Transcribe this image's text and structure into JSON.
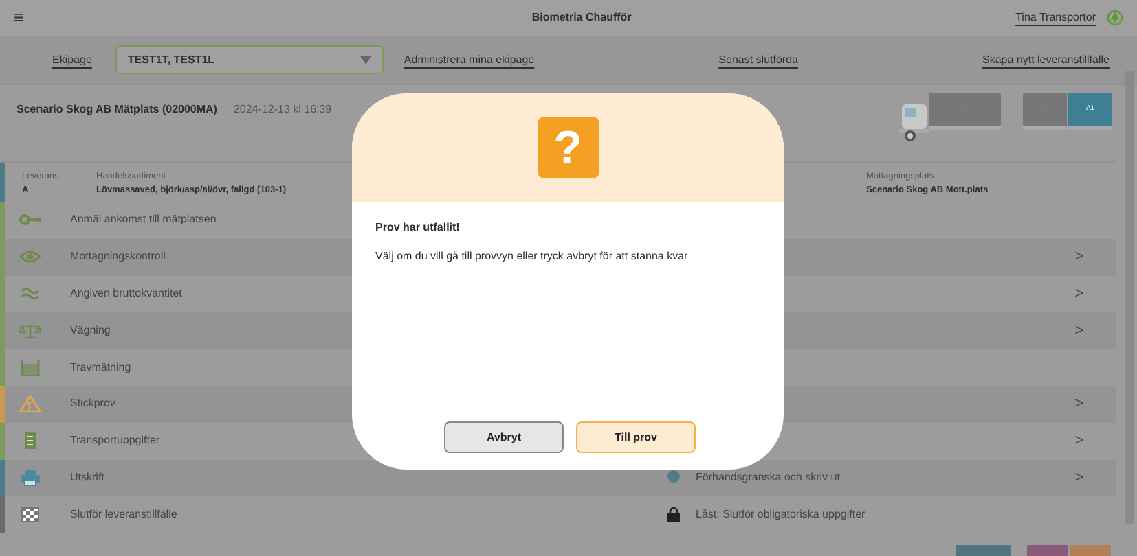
{
  "app_bar": {
    "menu": "≡",
    "title": "Biometria Chaufför",
    "user": "Tina Transportor"
  },
  "nav": {
    "ekipage_label": "Ekipage",
    "ekipage_value": "TEST1T, TEST1L",
    "links": [
      "Administrera mina ekipage",
      "Senast slutförda",
      "Skapa nytt leveranstillfälle"
    ]
  },
  "site": {
    "name": "Scenario Skog AB Mätplats (02000MA)",
    "timestamp": "2024-12-13 kl 16:39"
  },
  "truck": {
    "units": [
      {
        "label": "-",
        "selected": false
      },
      {
        "label": "-",
        "selected": false
      },
      {
        "label": "A1",
        "selected": true
      }
    ]
  },
  "delivery": {
    "color": "#4e7d8a",
    "fields": [
      {
        "label": "Leverans",
        "value": "A"
      },
      {
        "label": "Handelssortiment",
        "value": "Lövmassaved, björk/asp/al/övr, fallgd (103-1)"
      }
    ],
    "receiving": {
      "label": "Mottagningsplats",
      "value": "Scenario Skog AB Mott.plats"
    }
  },
  "steps": [
    {
      "kind": "step",
      "label": "Anmäl ankomst till mätplatsen",
      "color": "#7c9a5a"
    },
    {
      "kind": "step",
      "label": "Mottagningskontroll",
      "color": "#7c9a5a",
      "chevron": ">"
    },
    {
      "kind": "step",
      "label": "Angiven bruttokvantitet",
      "color": "#7c9a5a",
      "chevron": ">"
    },
    {
      "kind": "step",
      "label": "Vägning",
      "color": "#7c9a5a",
      "chevron": ">"
    },
    {
      "kind": "step",
      "label": "Travmätning",
      "color": "#7c9a5a"
    },
    {
      "kind": "step",
      "label": "Stickprov",
      "color": "#c8994f",
      "chevron": ">"
    },
    {
      "kind": "step",
      "label": "Transportuppgifter",
      "color": "#7c9a5a",
      "chevron": ">"
    },
    {
      "kind": "dot",
      "label": "Utskrift",
      "color": "#4e7d8a",
      "status": "Förhandsgranska och skriv ut",
      "chevron": ">"
    },
    {
      "kind": "lock",
      "label": "Slutför leveranstillfälle",
      "color": "#6a6a6a",
      "status": "Låst: Slutför obligatoriska uppgifter"
    }
  ],
  "footer_buttons": [
    {
      "color": "#4e7580"
    },
    {
      "color": "#8a5a78"
    },
    {
      "color": "#b0805a"
    }
  ],
  "modal": {
    "icon": "?",
    "title": "Prov har utfallit!",
    "message": "Välj om du vill gå till provvyn eller tryck avbryt för att stanna kvar",
    "buttons": [
      {
        "label": "Avbryt",
        "kind": "secondary"
      },
      {
        "label": "Till prov",
        "kind": "primary"
      }
    ]
  }
}
